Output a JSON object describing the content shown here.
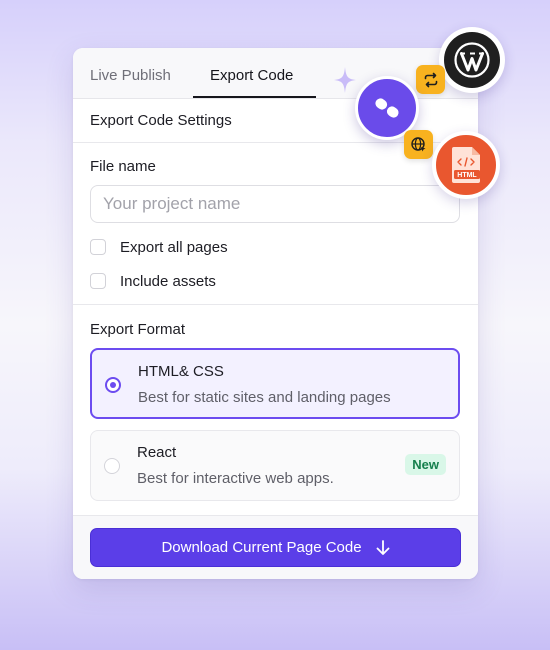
{
  "tabs": [
    {
      "label": "Live Publish",
      "active": false
    },
    {
      "label": "Export Code",
      "active": true
    }
  ],
  "settings_title": "Export Code Settings",
  "file_name": {
    "label": "File name",
    "value": "",
    "placeholder": "Your project name"
  },
  "options": [
    {
      "label": "Export all pages",
      "checked": false
    },
    {
      "label": "Include assets",
      "checked": false
    }
  ],
  "export_format": {
    "label": "Export Format",
    "formats": [
      {
        "title": "HTML& CSS",
        "description": "Best for static sites and landing pages",
        "selected": true
      },
      {
        "title": "React",
        "description": "Best for interactive web apps.",
        "selected": false,
        "badge": "New"
      }
    ]
  },
  "download_button": {
    "label": "Download Current Page Code",
    "icon": "arrow-down-icon"
  },
  "floating_icons": {
    "wordpress": "wordpress-logo-icon",
    "sync": "sync-arrows-icon",
    "app": "purple-app-logo-icon",
    "globe": "globe-icon",
    "html_file": "html-file-icon",
    "html_file_text": "HTML",
    "sparkle": "sparkle-icon"
  },
  "colors": {
    "accent": "#5b3ee8",
    "selected_border": "#6c4cf0",
    "badge_new_bg": "#d9f7e8",
    "badge_new_text": "#15804d",
    "html_orange": "#e9572f",
    "mini_yellow": "#f8b21f"
  }
}
